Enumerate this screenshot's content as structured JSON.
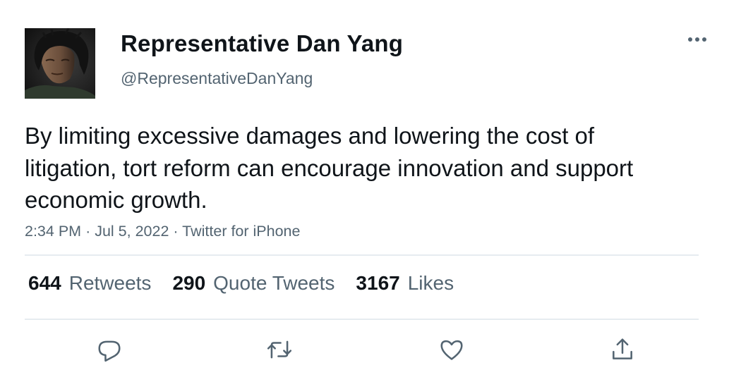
{
  "tweet": {
    "display_name": "Representative Dan Yang",
    "handle": "@RepresentativeDanYang",
    "text": "By limiting excessive damages and lowering the cost of litigation, tort reform can encourage innovation and support economic growth.",
    "time": "2:34 PM",
    "separator": "·",
    "date": "Jul 5, 2022",
    "source": "Twitter for iPhone"
  },
  "stats": {
    "retweets_count": "644",
    "retweets_label": "Retweets",
    "quotes_count": "290",
    "quotes_label": "Quote Tweets",
    "likes_count": "3167",
    "likes_label": "Likes"
  },
  "icons": {
    "more": "more-horizontal-icon",
    "reply": "reply-icon",
    "retweet": "retweet-icon",
    "like": "heart-icon",
    "share": "share-icon"
  },
  "colors": {
    "text_primary": "#0f1419",
    "text_secondary": "#536471",
    "divider": "#e6ecf0"
  }
}
